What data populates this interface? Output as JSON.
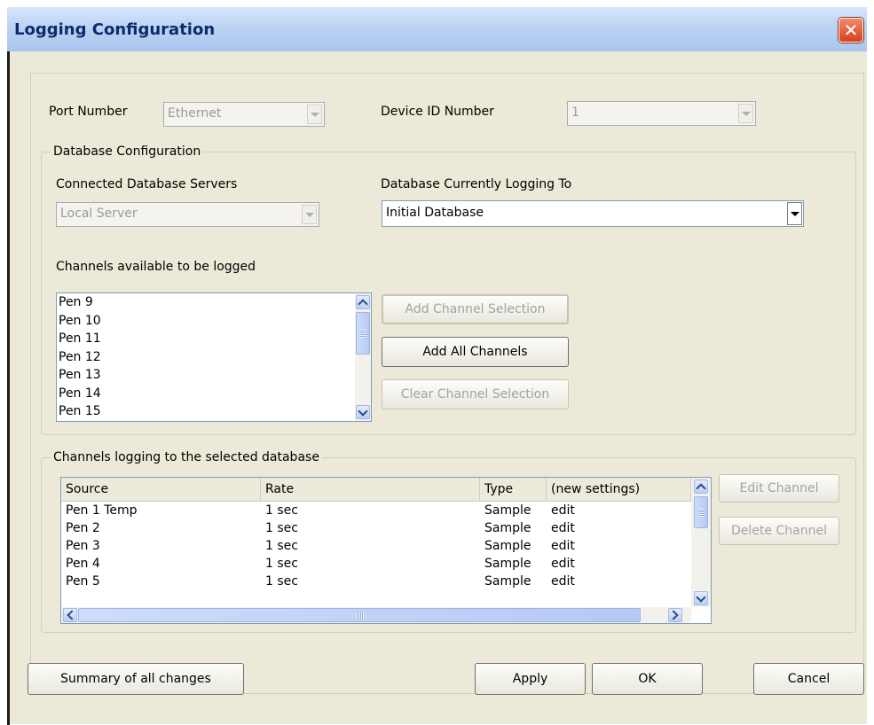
{
  "window": {
    "title": "Logging Configuration",
    "close_glyph": "✕"
  },
  "port": {
    "label": "Port Number",
    "value": "Ethernet"
  },
  "device": {
    "label": "Device ID Number",
    "value": "1"
  },
  "db_config": {
    "legend": "Database Configuration",
    "servers_label": "Connected Database Servers",
    "servers_value": "Local Server",
    "current_label": "Database Currently Logging To",
    "current_value": "Initial Database",
    "channels_label": "Channels available to be logged",
    "available_channels": [
      "Pen 9",
      "Pen 10",
      "Pen 11",
      "Pen 12",
      "Pen 13",
      "Pen 14",
      "Pen 15"
    ],
    "add_selection": "Add Channel Selection",
    "add_all": "Add All Channels",
    "clear_selection": "Clear Channel Selection"
  },
  "logging": {
    "legend": "Channels logging to the selected database",
    "columns": [
      "Source",
      "Rate",
      "Type",
      "(new settings)"
    ],
    "rows": [
      [
        "Pen 1 Temp",
        "1 sec",
        "Sample",
        "edit"
      ],
      [
        "Pen 2",
        "1 sec",
        "Sample",
        "edit"
      ],
      [
        "Pen 3",
        "1 sec",
        "Sample",
        "edit"
      ],
      [
        "Pen 4",
        "1 sec",
        "Sample",
        "edit"
      ],
      [
        "Pen 5",
        "1 sec",
        "Sample",
        "edit"
      ]
    ],
    "edit_channel": "Edit Channel",
    "delete_channel": "Delete Channel"
  },
  "footer": {
    "summary": "Summary of all changes",
    "apply": "Apply",
    "ok": "OK",
    "cancel": "Cancel"
  },
  "colors": {
    "title_text": "#0d2a6b",
    "client_bg": "#ece9d8",
    "close_red": "#d9401c"
  },
  "icons": [
    "close-icon",
    "chevron-down-icon",
    "chevron-up-icon",
    "chevron-left-icon",
    "chevron-right-icon"
  ]
}
